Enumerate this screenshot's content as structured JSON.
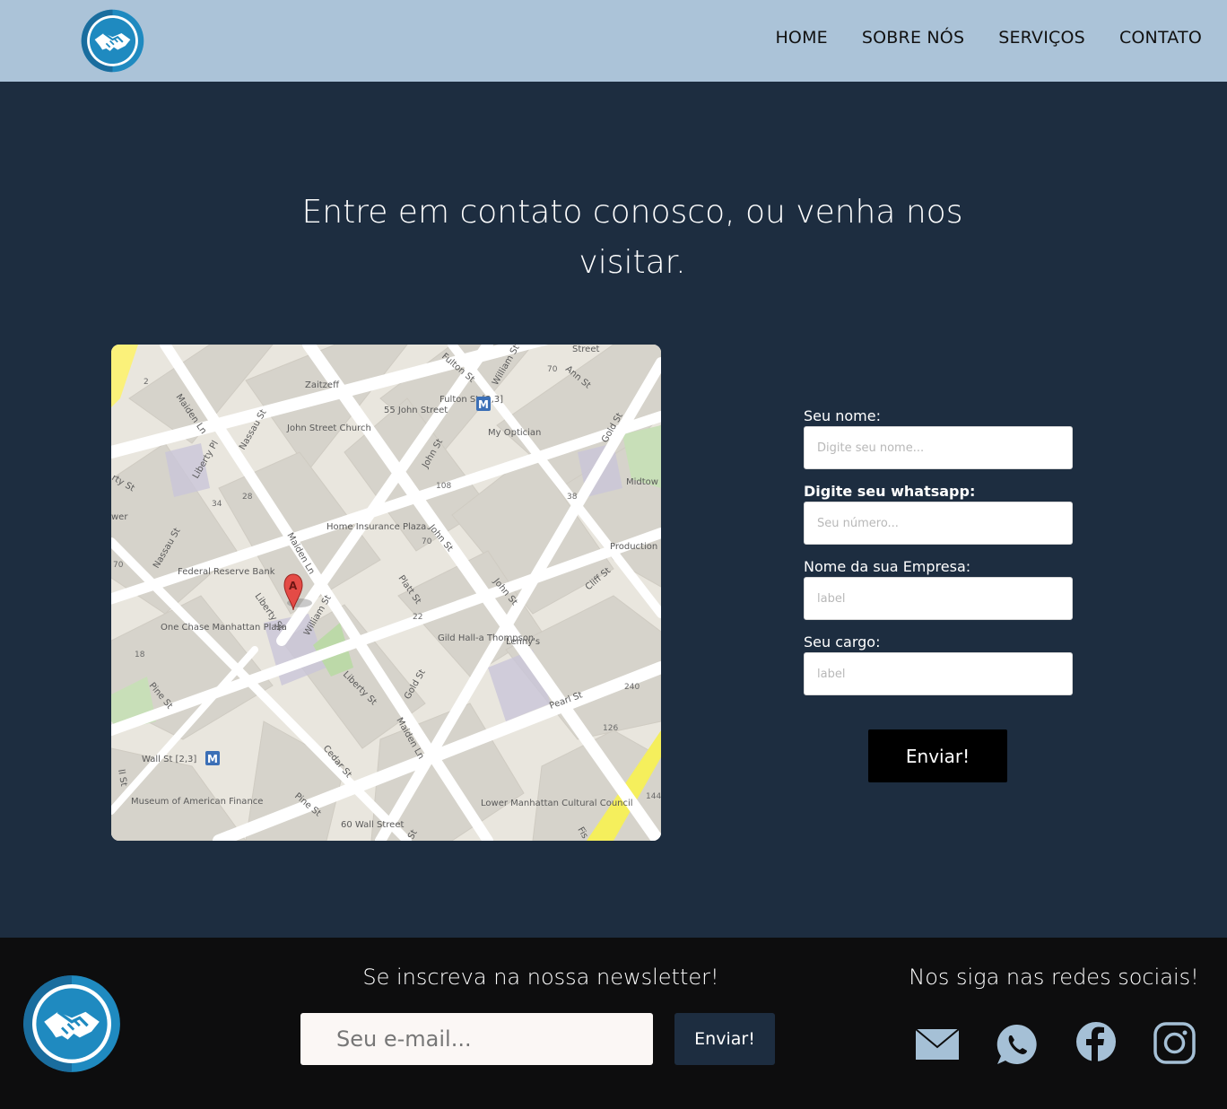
{
  "header": {
    "logo_icon": "handshake-icon",
    "nav": {
      "home": "HOME",
      "about": "SOBRE NÓS",
      "services": "SERVIÇOS",
      "contact": "CONTATO"
    }
  },
  "main": {
    "headline": "Entre em contato conosco, ou venha nos visitar.",
    "map": {
      "streets": {
        "maiden_ln_top": "Maiden Ln",
        "nassau_st_top": "Nassau St",
        "fulton_st": "Fulton St",
        "william_st_top": "William St",
        "ann_st": "Ann St",
        "gold_st_top": "Gold St",
        "liberty_pl": "Liberty Pl",
        "john_st_1": "John St",
        "nassau_st_left": "Nassau St",
        "maiden_ln_mid": "Maiden Ln",
        "platt_st": "Platt St",
        "john_st_2": "John St",
        "cliff_st": "Cliff St",
        "liberty_st_1": "Liberty St",
        "william_st_mid": "William St",
        "pine_st_1": "Pine St",
        "liberty_st_2": "Liberty St",
        "gold_st_mid": "Gold St",
        "maiden_ln_low": "Maiden Ln",
        "pearl_st": "Pearl St",
        "cedar_st": "Cedar St",
        "pine_st_2": "Pine St",
        "street_top": "Street",
        "rty_st": "rty St",
        "wer": "wer",
        "ll_st": "ll St",
        "fis": "Fis",
        "st_cut": "St"
      },
      "places": {
        "zaitzeff": "Zaitzeff",
        "john_street_church": "John Street Church",
        "fifty_five_john_street": "55 John Street",
        "fulton_st_station": "Fulton St [2,3]",
        "my_optician": "My Optician",
        "home_insurance_plaza": "Home Insurance Plaza",
        "federal_reserve_bank": "Federal Reserve Bank",
        "one_chase_manhattan_plaza": "One Chase Manhattan Plaza",
        "gild_hall": "Gild Hall-a Thompson",
        "lennys": "Lenny's",
        "midtown": "Midtow Downto",
        "production_dept": "Production Dept LLC",
        "wall_st_station": "Wall St [2,3]",
        "museum_american_finance": "Museum of American Finance",
        "sixty_wall_street": "60 Wall Street",
        "lower_manhattan_cultural_council": "Lower Manhattan Cultural Council"
      },
      "numbers": {
        "n2": "2",
        "n70a": "70",
        "n108": "108",
        "n34": "34",
        "n28": "28",
        "n38": "38",
        "n70b": "70",
        "n70c": "70",
        "n18": "18",
        "n22": "22",
        "n240": "240",
        "n126": "126",
        "n144": "144"
      },
      "marker_label": "A",
      "metro_label": "M"
    },
    "form": {
      "name_label": "Seu nome:",
      "name_placeholder": "Digite seu nome...",
      "whatsapp_label": "Digite seu whatsapp:",
      "whatsapp_placeholder": "Seu número...",
      "company_label": "Nome da sua Empresa:",
      "company_placeholder": "label",
      "role_label": "Seu cargo:",
      "role_placeholder": "label",
      "submit_label": "Enviar!"
    }
  },
  "footer": {
    "logo_icon": "handshake-icon",
    "newsletter_title": "Se inscreva na nossa newsletter!",
    "newsletter_placeholder": "Seu e-mail...",
    "newsletter_button": "Enviar!",
    "social_title": "Nos siga nas redes sociais!",
    "social_icons": [
      "mail-icon",
      "whatsapp-icon",
      "facebook-icon",
      "instagram-icon"
    ]
  },
  "colors": {
    "header_bg": "#abc3d8",
    "main_bg": "#1d2d40",
    "footer_bg": "#0d0d0e",
    "logo_blue": "#1f8ac0"
  }
}
